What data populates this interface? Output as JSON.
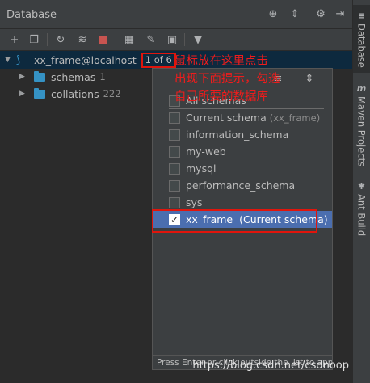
{
  "header": {
    "title": "Database"
  },
  "tree": {
    "root_label": "xx_frame@localhost",
    "root_badge": "1 of 6",
    "children": [
      {
        "label": "schemas",
        "count": "1"
      },
      {
        "label": "collations",
        "count": "222"
      }
    ]
  },
  "annotation": {
    "line1": "鼠标放在这里点击",
    "line2": "出现下面提示，勾选",
    "line3": "自己所要的数据库"
  },
  "popup": {
    "items": [
      {
        "label": "All schemas",
        "note": "",
        "checked": false
      },
      {
        "label": "Current schema",
        "note": "(xx_frame)",
        "checked": false
      },
      {
        "label": "information_schema",
        "note": "",
        "checked": false
      },
      {
        "label": "my-web",
        "note": "",
        "checked": false
      },
      {
        "label": "mysql",
        "note": "",
        "checked": false
      },
      {
        "label": "performance_schema",
        "note": "",
        "checked": false
      },
      {
        "label": "sys",
        "note": "",
        "checked": false
      },
      {
        "label": "xx_frame",
        "note": "(Current schema)",
        "checked": true
      }
    ],
    "footer": "Press Enter or click outside the list to apply"
  },
  "side_tabs": {
    "database": "Database",
    "maven": "Maven Projects",
    "ant": "Ant Build"
  },
  "watermark": "https://blog.csdn.net/csdnoop",
  "colors": {
    "background": "#3c3f41",
    "tree_background": "#2b2b2b",
    "selection": "#4b6eaf",
    "annotation_red": "#e0150c",
    "folder_blue": "#3592c4"
  }
}
